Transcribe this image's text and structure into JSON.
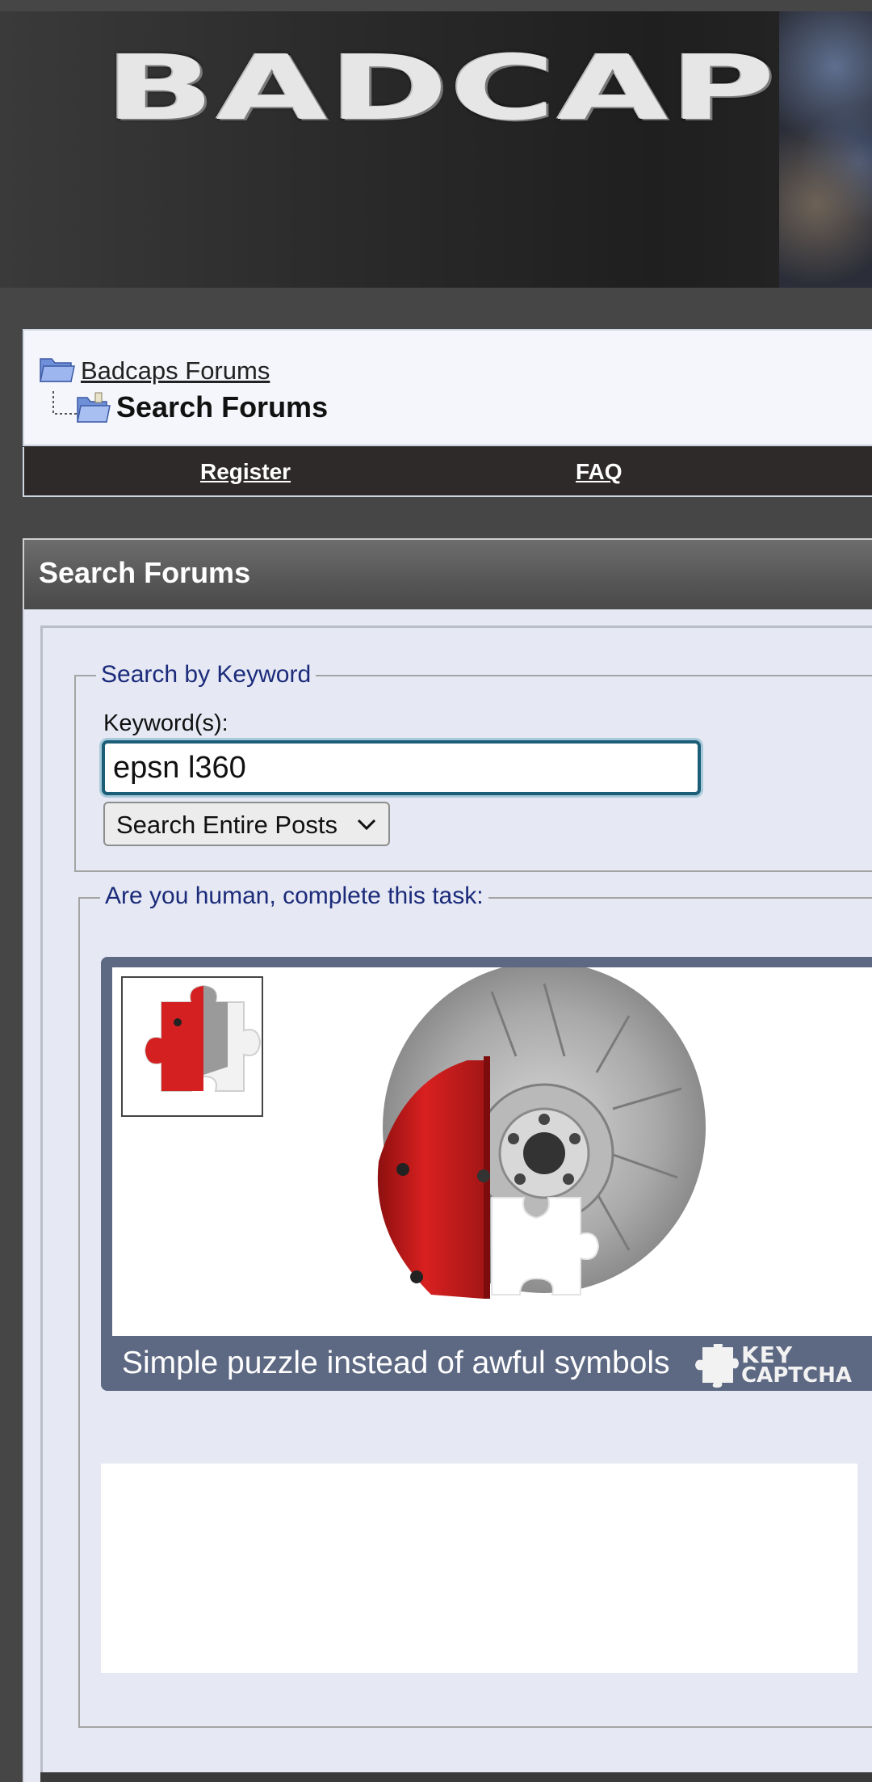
{
  "header": {
    "logo_text": "BADCAP"
  },
  "breadcrumb": {
    "parent_link": "Badcaps Forums",
    "current": "Search Forums"
  },
  "nav": {
    "items": [
      "Register",
      "FAQ"
    ]
  },
  "panel": {
    "title": "Search Forums"
  },
  "keyword_section": {
    "legend": "Search by Keyword",
    "label": "Keyword(s):",
    "value": "epsn l360",
    "select_value": "Search Entire Posts"
  },
  "captcha_section": {
    "legend": "Are you human, complete this task:",
    "caption": "Simple puzzle instead of awful symbols",
    "logo_line1": "KEY",
    "logo_line2": "CAPTCHA"
  },
  "colors": {
    "page_bg": "#464646",
    "legend_text": "#1b2b7a",
    "captcha_frame": "#5d6883",
    "nav_bg": "#2e2a29",
    "caliper_red": "#cf1f1f"
  },
  "icons": [
    "folder-icon",
    "tree-branch-icon",
    "folder-open-icon",
    "chevron-down-icon",
    "puzzle-piece-icon"
  ]
}
